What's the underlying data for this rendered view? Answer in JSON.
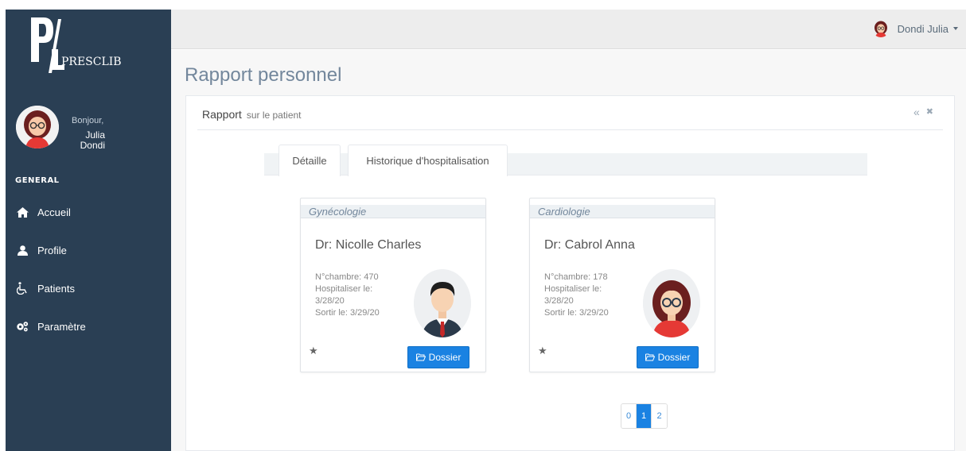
{
  "app": {
    "logo_letters": "PL",
    "logo_name": "PRESCLIB"
  },
  "sidebar": {
    "greeting": "Bonjour,",
    "user_first": "Julia",
    "user_last": "Dondi",
    "section": "GENERAL",
    "items": [
      {
        "label": "Accueil",
        "icon": "home-icon"
      },
      {
        "label": "Profile",
        "icon": "user-icon"
      },
      {
        "label": "Patients",
        "icon": "wheelchair-icon"
      },
      {
        "label": "Paramètre",
        "icon": "gears-icon"
      }
    ]
  },
  "topbar": {
    "user_name": "Dondi Julia"
  },
  "page": {
    "title": "Rapport personnel"
  },
  "panel": {
    "title": "Rapport",
    "subtitle": "sur le patient",
    "tools": {
      "collapse": "«",
      "close": "✖"
    }
  },
  "tabs": [
    {
      "label": "Détaille"
    },
    {
      "label": "Historique d'hospitalisation"
    }
  ],
  "cards": [
    {
      "specialty": "Gynécologie",
      "doctor": "Dr: Nicolle Charles",
      "room": "N°chambre: 470",
      "hosp_label": "Hospitaliser le:",
      "hosp_date": "3/28/20",
      "exit": "Sortir le: 3/29/20",
      "button": "Dossier",
      "avatar": "male-doctor-avatar"
    },
    {
      "specialty": "Cardiologie",
      "doctor": "Dr: Cabrol Anna",
      "room": "N°chambre: 178",
      "hosp_label": "Hospitaliser le:",
      "hosp_date": "3/28/20",
      "exit": "Sortir le: 3/29/20",
      "button": "Dossier",
      "avatar": "female-doctor-avatar"
    }
  ],
  "pagination": {
    "pages": [
      "0",
      "1",
      "2"
    ],
    "active": "1"
  },
  "colors": {
    "sidebar": "#2a3f54",
    "primary": "#1a82e2",
    "title": "#73879c"
  }
}
